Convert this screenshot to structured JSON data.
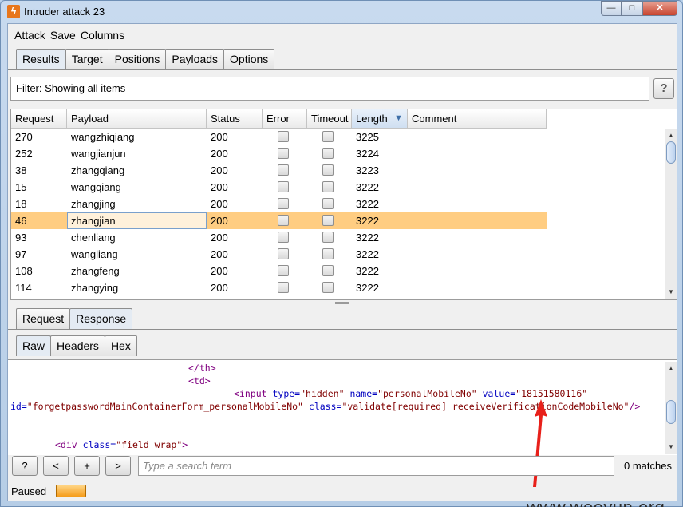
{
  "window": {
    "title": "Intruder attack 23",
    "controls": {
      "minimize": "—",
      "maximize": "□",
      "close": "✕"
    }
  },
  "menu": [
    "Attack",
    "Save",
    "Columns"
  ],
  "main_tabs": [
    {
      "label": "Results",
      "active": true
    },
    {
      "label": "Target",
      "active": false
    },
    {
      "label": "Positions",
      "active": false
    },
    {
      "label": "Payloads",
      "active": false
    },
    {
      "label": "Options",
      "active": false
    }
  ],
  "filter": {
    "text": "Filter: Showing all items",
    "help_label": "?"
  },
  "table": {
    "columns": [
      "Request",
      "Payload",
      "Status",
      "Error",
      "Timeout",
      "Length",
      "Comment"
    ],
    "sorted_column": "Length",
    "sort_indicator": "▼",
    "rows": [
      {
        "request": "270",
        "payload": "wangzhiqiang",
        "status": "200",
        "error": false,
        "timeout": false,
        "length": "3225",
        "comment": ""
      },
      {
        "request": "252",
        "payload": "wangjianjun",
        "status": "200",
        "error": false,
        "timeout": false,
        "length": "3224",
        "comment": ""
      },
      {
        "request": "38",
        "payload": "zhangqiang",
        "status": "200",
        "error": false,
        "timeout": false,
        "length": "3223",
        "comment": ""
      },
      {
        "request": "15",
        "payload": "wangqiang",
        "status": "200",
        "error": false,
        "timeout": false,
        "length": "3222",
        "comment": ""
      },
      {
        "request": "18",
        "payload": "zhangjing",
        "status": "200",
        "error": false,
        "timeout": false,
        "length": "3222",
        "comment": ""
      },
      {
        "request": "46",
        "payload": "zhangjian",
        "status": "200",
        "error": false,
        "timeout": false,
        "length": "3222",
        "comment": "",
        "selected": true
      },
      {
        "request": "93",
        "payload": "chenliang",
        "status": "200",
        "error": false,
        "timeout": false,
        "length": "3222",
        "comment": ""
      },
      {
        "request": "97",
        "payload": "wangliang",
        "status": "200",
        "error": false,
        "timeout": false,
        "length": "3222",
        "comment": ""
      },
      {
        "request": "108",
        "payload": "zhangfeng",
        "status": "200",
        "error": false,
        "timeout": false,
        "length": "3222",
        "comment": ""
      },
      {
        "request": "114",
        "payload": "zhangying",
        "status": "200",
        "error": false,
        "timeout": false,
        "length": "3222",
        "comment": ""
      }
    ]
  },
  "detail_tabs": [
    {
      "label": "Request",
      "active": false
    },
    {
      "label": "Response",
      "active": true
    }
  ],
  "view_tabs": [
    {
      "label": "Raw",
      "active": true
    },
    {
      "label": "Headers",
      "active": false
    },
    {
      "label": "Hex",
      "active": false
    }
  ],
  "response_code": {
    "line1": "</th>",
    "line2": "<td>",
    "input_tag": "<input",
    "attr_type": "type=",
    "val_type": "\"hidden\"",
    "attr_name": "name=",
    "val_name": "\"personalMobileNo\"",
    "attr_value": "value=",
    "val_value": "\"18151580116\"",
    "attr_id": "id=",
    "val_id": "\"forgetpasswordMainContainerForm_personalMobileNo\"",
    "attr_class": "class=",
    "val_class": "\"validate[required] receiveVerificationCodeMobileNo\"",
    "close": "/>",
    "div_tag": "<div",
    "div_attr": "class=",
    "div_val": "\"field_wrap\"",
    "div_close": ">"
  },
  "search": {
    "help_label": "?",
    "prev_label": "<",
    "add_label": "+",
    "next_label": ">",
    "placeholder": "Type a search term",
    "matches": "0 matches"
  },
  "status": {
    "text": "Paused",
    "progress": 0.05
  },
  "watermark": "www.wooyun.org",
  "colors": {
    "selected_row": "#ffcd82",
    "progress": "#f59c1a",
    "annotation_arrow": "#e8201a"
  }
}
